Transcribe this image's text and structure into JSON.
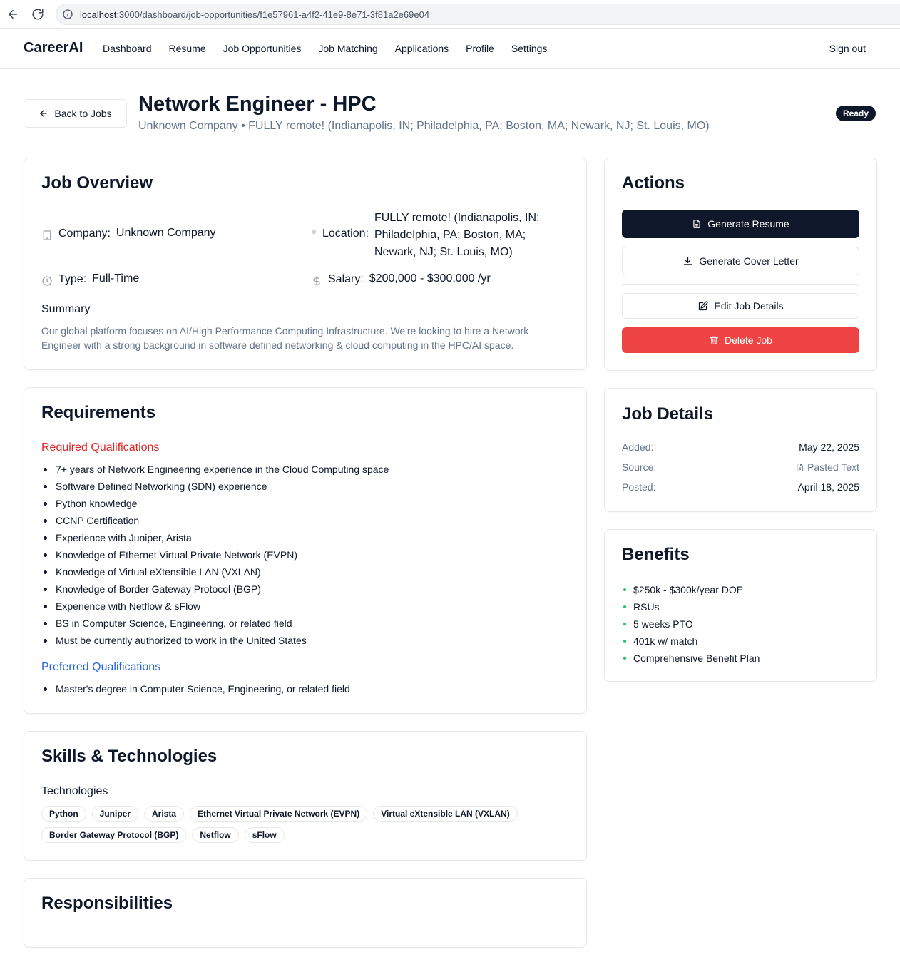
{
  "browser": {
    "url_host": "localhost",
    "url_rest": ":3000/dashboard/job-opportunities/f1e57961-a4f2-41e9-8e71-3f81a2e69e04"
  },
  "header": {
    "brand": "CareerAI",
    "nav": [
      "Dashboard",
      "Resume",
      "Job Opportunities",
      "Job Matching",
      "Applications",
      "Profile",
      "Settings"
    ],
    "sign_out": "Sign out"
  },
  "page": {
    "back_label": "Back to Jobs",
    "title": "Network Engineer - HPC",
    "subtitle": "Unknown Company • FULLY remote! (Indianapolis, IN; Philadelphia, PA; Boston, MA; Newark, NJ; St. Louis, MO)",
    "status": "Ready"
  },
  "overview": {
    "heading": "Job Overview",
    "company_label": "Company:",
    "company_value": "Unknown Company",
    "location_label": "Location:",
    "location_value": "FULLY remote! (Indianapolis, IN; Philadelphia, PA; Boston, MA; Newark, NJ; St. Louis, MO)",
    "type_label": "Type:",
    "type_value": "Full-Time",
    "salary_label": "Salary:",
    "salary_value": "$200,000 - $300,000 /yr",
    "summary_heading": "Summary",
    "summary_text": "Our global platform focuses on AI/High Performance Computing Infrastructure. We're looking to hire a Network Engineer with a strong background in software defined networking & cloud computing in the HPC/AI space."
  },
  "actions": {
    "heading": "Actions",
    "generate_resume": "Generate Resume",
    "generate_cover_letter": "Generate Cover Letter",
    "edit_job": "Edit Job Details",
    "delete_job": "Delete Job"
  },
  "requirements": {
    "heading": "Requirements",
    "required_heading": "Required Qualifications",
    "required": [
      "7+ years of Network Engineering experience in the Cloud Computing space",
      "Software Defined Networking (SDN) experience",
      "Python knowledge",
      "CCNP Certification",
      "Experience with Juniper, Arista",
      "Knowledge of Ethernet Virtual Private Network (EVPN)",
      "Knowledge of Virtual eXtensible LAN (VXLAN)",
      "Knowledge of Border Gateway Protocol (BGP)",
      "Experience with Netflow & sFlow",
      "BS in Computer Science, Engineering, or related field",
      "Must be currently authorized to work in the United States"
    ],
    "preferred_heading": "Preferred Qualifications",
    "preferred": [
      "Master's degree in Computer Science, Engineering, or related field"
    ]
  },
  "job_details": {
    "heading": "Job Details",
    "added_label": "Added:",
    "added_value": "May 22, 2025",
    "source_label": "Source:",
    "source_value": "Pasted Text",
    "posted_label": "Posted:",
    "posted_value": "April 18, 2025"
  },
  "benefits": {
    "heading": "Benefits",
    "items": [
      "$250k - $300k/year DOE",
      "RSUs",
      "5 weeks PTO",
      "401k w/ match",
      "Comprehensive Benefit Plan"
    ]
  },
  "skills": {
    "heading": "Skills & Technologies",
    "tech_heading": "Technologies",
    "tags": [
      "Python",
      "Juniper",
      "Arista",
      "Ethernet Virtual Private Network (EVPN)",
      "Virtual eXtensible LAN (VXLAN)",
      "Border Gateway Protocol (BGP)",
      "Netflow",
      "sFlow"
    ]
  },
  "responsibilities": {
    "heading": "Responsibilities"
  },
  "colors": {
    "primary": "#0f172a",
    "danger": "#ef4444",
    "required_heading": "#dc2626",
    "preferred_heading": "#2563eb",
    "benefit_bullet": "#22c55e",
    "muted": "#64748b"
  }
}
